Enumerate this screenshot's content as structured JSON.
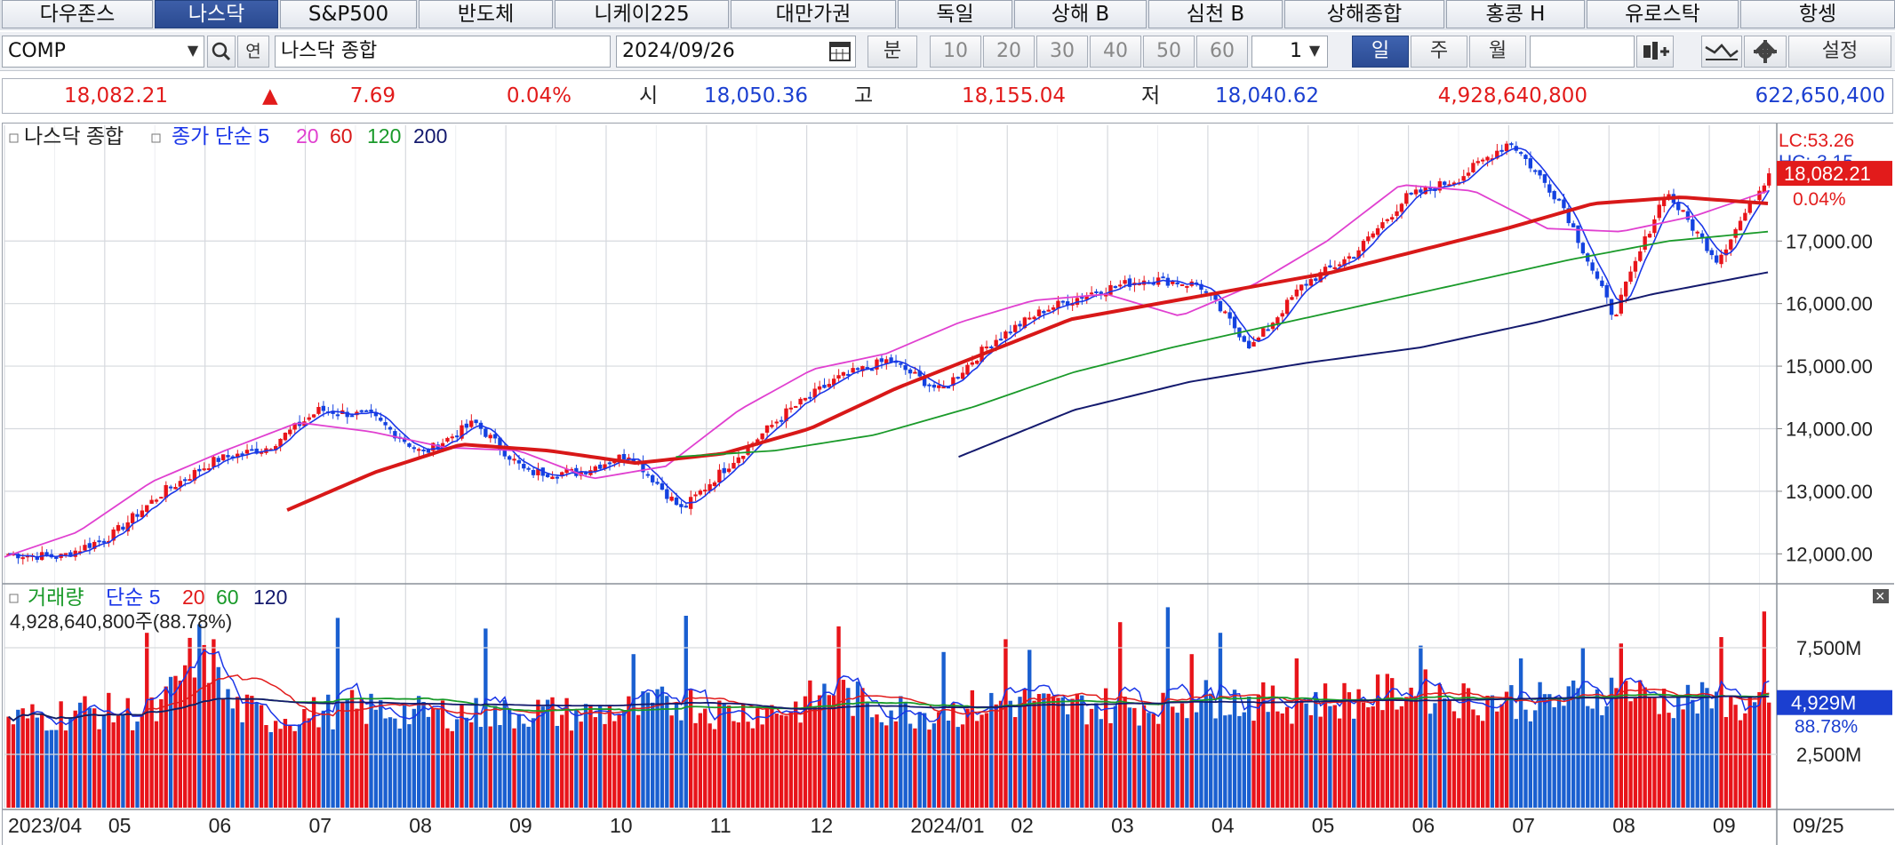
{
  "market_tabs": [
    {
      "label": "다우존스",
      "active": false
    },
    {
      "label": "나스닥",
      "active": true
    },
    {
      "label": "S&P500",
      "active": false
    },
    {
      "label": "반도체",
      "active": false
    },
    {
      "label": "니케이225",
      "active": false
    },
    {
      "label": "대만가권",
      "active": false
    },
    {
      "label": "독일",
      "active": false
    },
    {
      "label": "상해 B",
      "active": false
    },
    {
      "label": "심천 B",
      "active": false
    },
    {
      "label": "상해종합",
      "active": false
    },
    {
      "label": "홍콩 H",
      "active": false
    },
    {
      "label": "유로스탁",
      "active": false
    },
    {
      "label": "항셍",
      "active": false
    }
  ],
  "toolbar": {
    "symbol": "COMP",
    "index_name": "나스닥 종합",
    "date": "2024/09/26",
    "minute_label": "분",
    "intervals": [
      "10",
      "20",
      "30",
      "40",
      "50",
      "60"
    ],
    "count_value": "1",
    "period_day": "일",
    "period_week": "주",
    "period_month": "월",
    "settings_label": "설정",
    "search_icon": "search-icon",
    "calendar_icon": "calendar-icon"
  },
  "quote": {
    "last": "18,082.21",
    "change_arrow": "▲",
    "change": "7.69",
    "change_pct": "0.04%",
    "open_label": "시",
    "open": "18,050.36",
    "high_label": "고",
    "high": "18,155.04",
    "low_label": "저",
    "low": "18,040.62",
    "volume": "4,928,640,800",
    "value": "622,650,400",
    "up_color": "#e21b1b",
    "down_color": "#1b3fd0"
  },
  "chart_data": [
    {
      "type": "line",
      "title": "나스닥 종합",
      "legend": [
        "종가 단순 5",
        "20",
        "60",
        "120",
        "200"
      ],
      "legend_prefix": "나스닥 종합",
      "x_tick_labels": [
        "2023/04",
        "05",
        "06",
        "07",
        "08",
        "09",
        "10",
        "11",
        "12",
        "2024/01",
        "02",
        "03",
        "04",
        "05",
        "06",
        "07",
        "08",
        "09"
      ],
      "last_date_label": "09/25",
      "y_ticks": [
        "12,000.00",
        "13,000.00",
        "14,000.00",
        "15,000.00",
        "16,000.00",
        "17,000.00"
      ],
      "ylim": [
        11550,
        18850
      ],
      "lc_label": "LC:53.26",
      "hc_label": "HC:-3.15",
      "last_price_label": "18,082.21",
      "last_pct_label": "0.04%",
      "close_points": [
        {
          "x": "2023/04",
          "y": 12000
        },
        {
          "x": "05 (early)",
          "y": 11950
        },
        {
          "x": "05 (mid)",
          "y": 12300
        },
        {
          "x": "06 (early)",
          "y": 13000
        },
        {
          "x": "06 (mid)",
          "y": 13500
        },
        {
          "x": "07 (early)",
          "y": 13700
        },
        {
          "x": "07 (late)",
          "y": 14300
        },
        {
          "x": "08 (early)",
          "y": 14200
        },
        {
          "x": "08 (mid)",
          "y": 13600
        },
        {
          "x": "09 (early)",
          "y": 14100
        },
        {
          "x": "09 (late)",
          "y": 13300
        },
        {
          "x": "10 (early)",
          "y": 13300
        },
        {
          "x": "10 (mid)",
          "y": 13600
        },
        {
          "x": "10 (late)",
          "y": 12700
        },
        {
          "x": "11 (early)",
          "y": 13500
        },
        {
          "x": "11 (late)",
          "y": 14250
        },
        {
          "x": "12 (mid)",
          "y": 14800
        },
        {
          "x": "12 (late)",
          "y": 15100
        },
        {
          "x": "2024/01 (early)",
          "y": 14600
        },
        {
          "x": "2024/01 (late)",
          "y": 15400
        },
        {
          "x": "02 (mid)",
          "y": 15900
        },
        {
          "x": "03 (early)",
          "y": 16200
        },
        {
          "x": "03 (late)",
          "y": 16400
        },
        {
          "x": "04 (early)",
          "y": 16300
        },
        {
          "x": "04 (late)",
          "y": 15300
        },
        {
          "x": "05 (early)",
          "y": 16300
        },
        {
          "x": "05 (late)",
          "y": 16800
        },
        {
          "x": "06 (mid)",
          "y": 17700
        },
        {
          "x": "07 (early)",
          "y": 18000
        },
        {
          "x": "07 (mid)",
          "y": 18600
        },
        {
          "x": "07 (late)",
          "y": 17600
        },
        {
          "x": "08 (early)",
          "y": 15800
        },
        {
          "x": "08 (late)",
          "y": 17800
        },
        {
          "x": "09 (early)",
          "y": 16700
        },
        {
          "x": "09/25",
          "y": 18082
        }
      ],
      "ma_series": [
        {
          "name": "20",
          "color": "#e040d0",
          "start": 0.0,
          "values": [
            11950,
            12350,
            13150,
            13650,
            14100,
            13950,
            13700,
            13650,
            13200,
            13400,
            14300,
            14950,
            15200,
            15700,
            16050,
            16150,
            15800,
            16300,
            17000,
            17900,
            17800,
            17200,
            17150,
            17400,
            17800
          ]
        },
        {
          "name": "60",
          "color": "#d81818",
          "start": 0.16,
          "values": [
            12700,
            13300,
            13750,
            13650,
            13450,
            13600,
            14000,
            14650,
            15200,
            15750,
            16000,
            16250,
            16500,
            16850,
            17200,
            17600,
            17700,
            17600
          ]
        },
        {
          "name": "120",
          "color": "#1a9a2a",
          "start": 0.38,
          "values": [
            13550,
            13650,
            13900,
            14350,
            14900,
            15300,
            15650,
            16000,
            16350,
            16700,
            17000,
            17150
          ]
        },
        {
          "name": "200",
          "color": "#141a6e",
          "start": 0.54,
          "values": [
            13550,
            14300,
            14750,
            15050,
            15300,
            15700,
            16150,
            16500
          ]
        }
      ]
    },
    {
      "type": "bar",
      "title": "거래량",
      "legend": [
        "단순 5",
        "20",
        "60",
        "120"
      ],
      "current_label": "4,928,640,800주(88.78%)",
      "y_ticks": [
        "2,500M",
        "7,500M"
      ],
      "ylim": [
        0,
        10000
      ],
      "last_volume_label": "4,929M",
      "last_pct_label": "88.78%",
      "volume_profile_millions": [
        4600,
        4800,
        5100,
        5000,
        4900,
        8100,
        5300,
        4700,
        4900,
        5200,
        5100,
        4900,
        5000,
        4800,
        5100,
        4900,
        5000,
        5200,
        5600,
        5000,
        5100,
        5200,
        6200,
        5300,
        5100,
        5000,
        5300,
        5600,
        5200,
        5400,
        5300,
        5500,
        5700,
        5600,
        5400,
        5600,
        5700,
        6000,
        6100,
        5600,
        5700,
        5500,
        5800,
        6200,
        5700,
        5600,
        5300,
        5500
      ]
    }
  ]
}
